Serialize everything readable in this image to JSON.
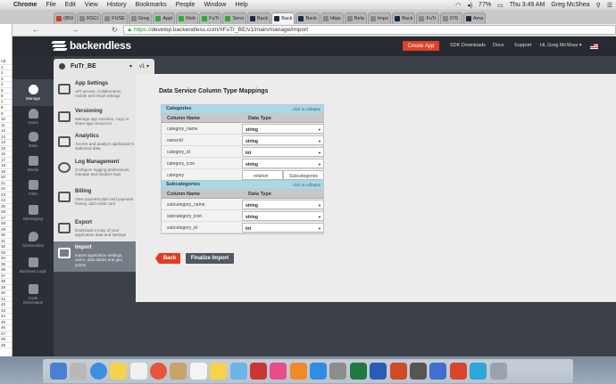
{
  "menubar": {
    "app": "Chrome",
    "items": [
      "File",
      "Edit",
      "View",
      "History",
      "Bookmarks",
      "People",
      "Window",
      "Help"
    ],
    "battery": "77%",
    "time": "Thu 3:49 AM",
    "user": "Greg McShea"
  },
  "tabs": [
    "(859",
    "RSCI",
    "FUSE",
    "Greg",
    "Appl",
    "Mob",
    "FuTr",
    "Servi",
    "Back",
    "Back",
    "Back",
    "https",
    "Rela",
    "Impo",
    "Back",
    "FuTr",
    "076",
    "Ama"
  ],
  "address": {
    "scheme": "https://",
    "rest": "develop.backendless.com/#FuTr_BE/v1/main/manage/import"
  },
  "sheet": {
    "col": "LB",
    "rows": [
      "1",
      "2",
      "3",
      "4",
      "5",
      "6",
      "7",
      "8",
      "9",
      "10",
      "11",
      "12",
      "13",
      "14",
      "15",
      "16",
      "17",
      "18",
      "19",
      "20",
      "21",
      "22",
      "23",
      "24",
      "25",
      "26",
      "27",
      "28",
      "29",
      "30",
      "31",
      "32",
      "33",
      "34",
      "35",
      "36",
      "37",
      "38",
      "39",
      "40",
      "41",
      "42",
      "43",
      "44",
      "45",
      "46",
      "47",
      "48",
      "49"
    ]
  },
  "topnav": {
    "logo": "backendless",
    "create_app": "Create App",
    "sdk": "SDK Downloads",
    "docs": "Docs",
    "support": "Support",
    "user": "Hi, Greg McShea ▾"
  },
  "sidebar": [
    {
      "label": "Manage"
    },
    {
      "label": "Users"
    },
    {
      "label": "Data"
    },
    {
      "label": "Media"
    },
    {
      "label": "Files"
    },
    {
      "label": "Messaging"
    },
    {
      "label": "Geolocation"
    },
    {
      "label": "Business Logic"
    },
    {
      "label": "Code Generation"
    }
  ],
  "app_selector": {
    "name": "FuTr_BE",
    "version": "v1 ▾"
  },
  "menu": [
    {
      "title": "App Settings",
      "desc": "API access, Collaboration, mobile and email settings"
    },
    {
      "title": "Versioning",
      "desc": "Manage app versions, copy or share app resources"
    },
    {
      "title": "Analytics",
      "desc": "Access and analyze application's statistical data"
    },
    {
      "title": "Log Management",
      "desc": "Configure logging preferences, manage and analyze logs"
    },
    {
      "title": "Billing",
      "desc": "View payment plan and payment history, add credit card"
    },
    {
      "title": "Export",
      "desc": "Download a copy of your application data and settings"
    },
    {
      "title": "Import",
      "desc": "Import application settings, users, data tables and geo points"
    }
  ],
  "main": {
    "title": "Data Service Column Type Mappings",
    "col_name": "Column Name",
    "data_type": "Data Type",
    "collapse": "click to collapse",
    "tables": [
      {
        "name": "Categories",
        "rows": [
          {
            "name": "category_name",
            "type": "string"
          },
          {
            "name": "ownerId",
            "type": "string"
          },
          {
            "name": "category_id",
            "type": "int"
          },
          {
            "name": "category_icon",
            "type": "string"
          },
          {
            "name": "category",
            "type": "relation",
            "target": "Subcategories"
          }
        ]
      },
      {
        "name": "Subcategories",
        "rows": [
          {
            "name": "subcategory_name",
            "type": "string"
          },
          {
            "name": "subcategory_icon",
            "type": "string"
          },
          {
            "name": "subcategory_id",
            "type": "int"
          }
        ]
      }
    ],
    "back": "Back",
    "finalize": "Finalize Import"
  },
  "dock_icons": [
    "finder-icon",
    "launchpad-icon",
    "safari-icon",
    "stickies-icon",
    "photos-icon",
    "chrome-icon",
    "contacts-icon",
    "calendar-icon",
    "notes-icon",
    "preview-icon",
    "photo-booth-icon",
    "itunes-icon",
    "ibooks-icon",
    "app-store-icon",
    "preferences-icon",
    "excel-icon",
    "word-icon",
    "powerpoint-icon",
    "utility-icon",
    "keynote-icon",
    "wunderlist-icon",
    "terminal-icon",
    "trash-icon"
  ]
}
